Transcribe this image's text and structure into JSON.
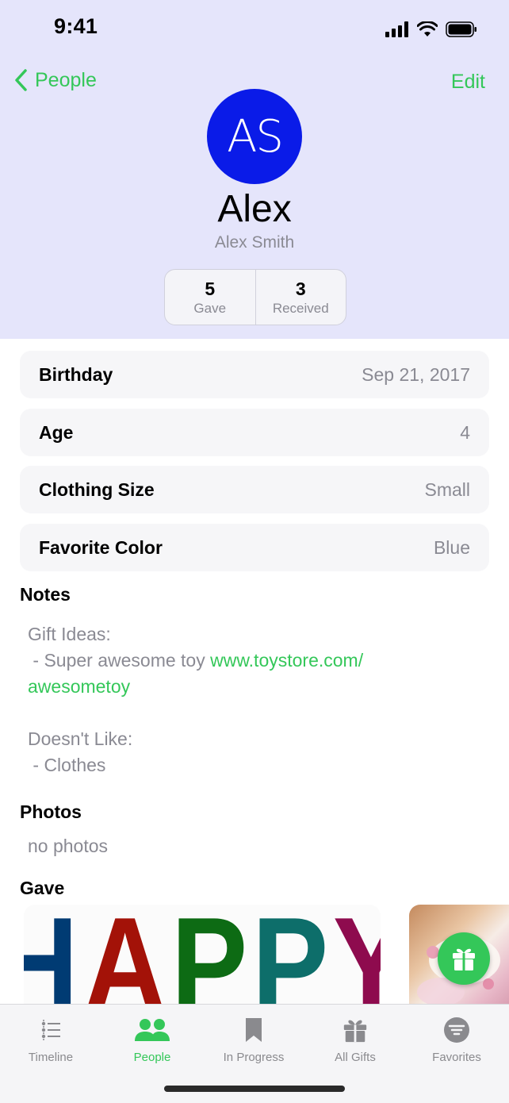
{
  "status_bar": {
    "time": "9:41"
  },
  "nav": {
    "back_label": "People",
    "edit_label": "Edit"
  },
  "profile": {
    "initials": "AS",
    "name": "Alex",
    "full_name": "Alex Smith",
    "avatar_color": "#0a1be8",
    "stats": [
      {
        "value": "5",
        "label": "Gave"
      },
      {
        "value": "3",
        "label": "Received"
      }
    ]
  },
  "details": [
    {
      "label": "Birthday",
      "value": "Sep 21, 2017"
    },
    {
      "label": "Age",
      "value": "4"
    },
    {
      "label": "Clothing Size",
      "value": "Small"
    },
    {
      "label": "Favorite Color",
      "value": "Blue"
    }
  ],
  "notes": {
    "title": "Notes",
    "gift_ideas_heading": "Gift Ideas:",
    "gift_ideas_item": " - Super awesome toy ",
    "gift_ideas_link_part1": "www.toystore.com/",
    "gift_ideas_link_part2": "awesometoy",
    "dislikes_heading": "Doesn't Like:",
    "dislikes_item": " - Clothes"
  },
  "photos": {
    "title": "Photos",
    "empty_text": "no photos"
  },
  "gave": {
    "title": "Gave",
    "cards": [
      {
        "letters": [
          "H",
          "A",
          "P",
          "P",
          "Y"
        ],
        "letter_colors": [
          "#003b73",
          "#a31208",
          "#0d6b14",
          "#0d6e6a",
          "#8e0b4e"
        ]
      },
      {
        "description": "teacup photo"
      }
    ]
  },
  "tabbar": {
    "tabs": [
      {
        "label": "Timeline",
        "icon": "timeline-icon",
        "active": false
      },
      {
        "label": "People",
        "icon": "people-icon",
        "active": true
      },
      {
        "label": "In Progress",
        "icon": "bookmark-icon",
        "active": false
      },
      {
        "label": "All Gifts",
        "icon": "gift-icon",
        "active": false
      },
      {
        "label": "Favorites",
        "icon": "filter-icon",
        "active": false
      }
    ]
  },
  "colors": {
    "accent": "#34c759",
    "header_bg": "#e5e5fb",
    "secondary_text": "#8a8a93"
  }
}
